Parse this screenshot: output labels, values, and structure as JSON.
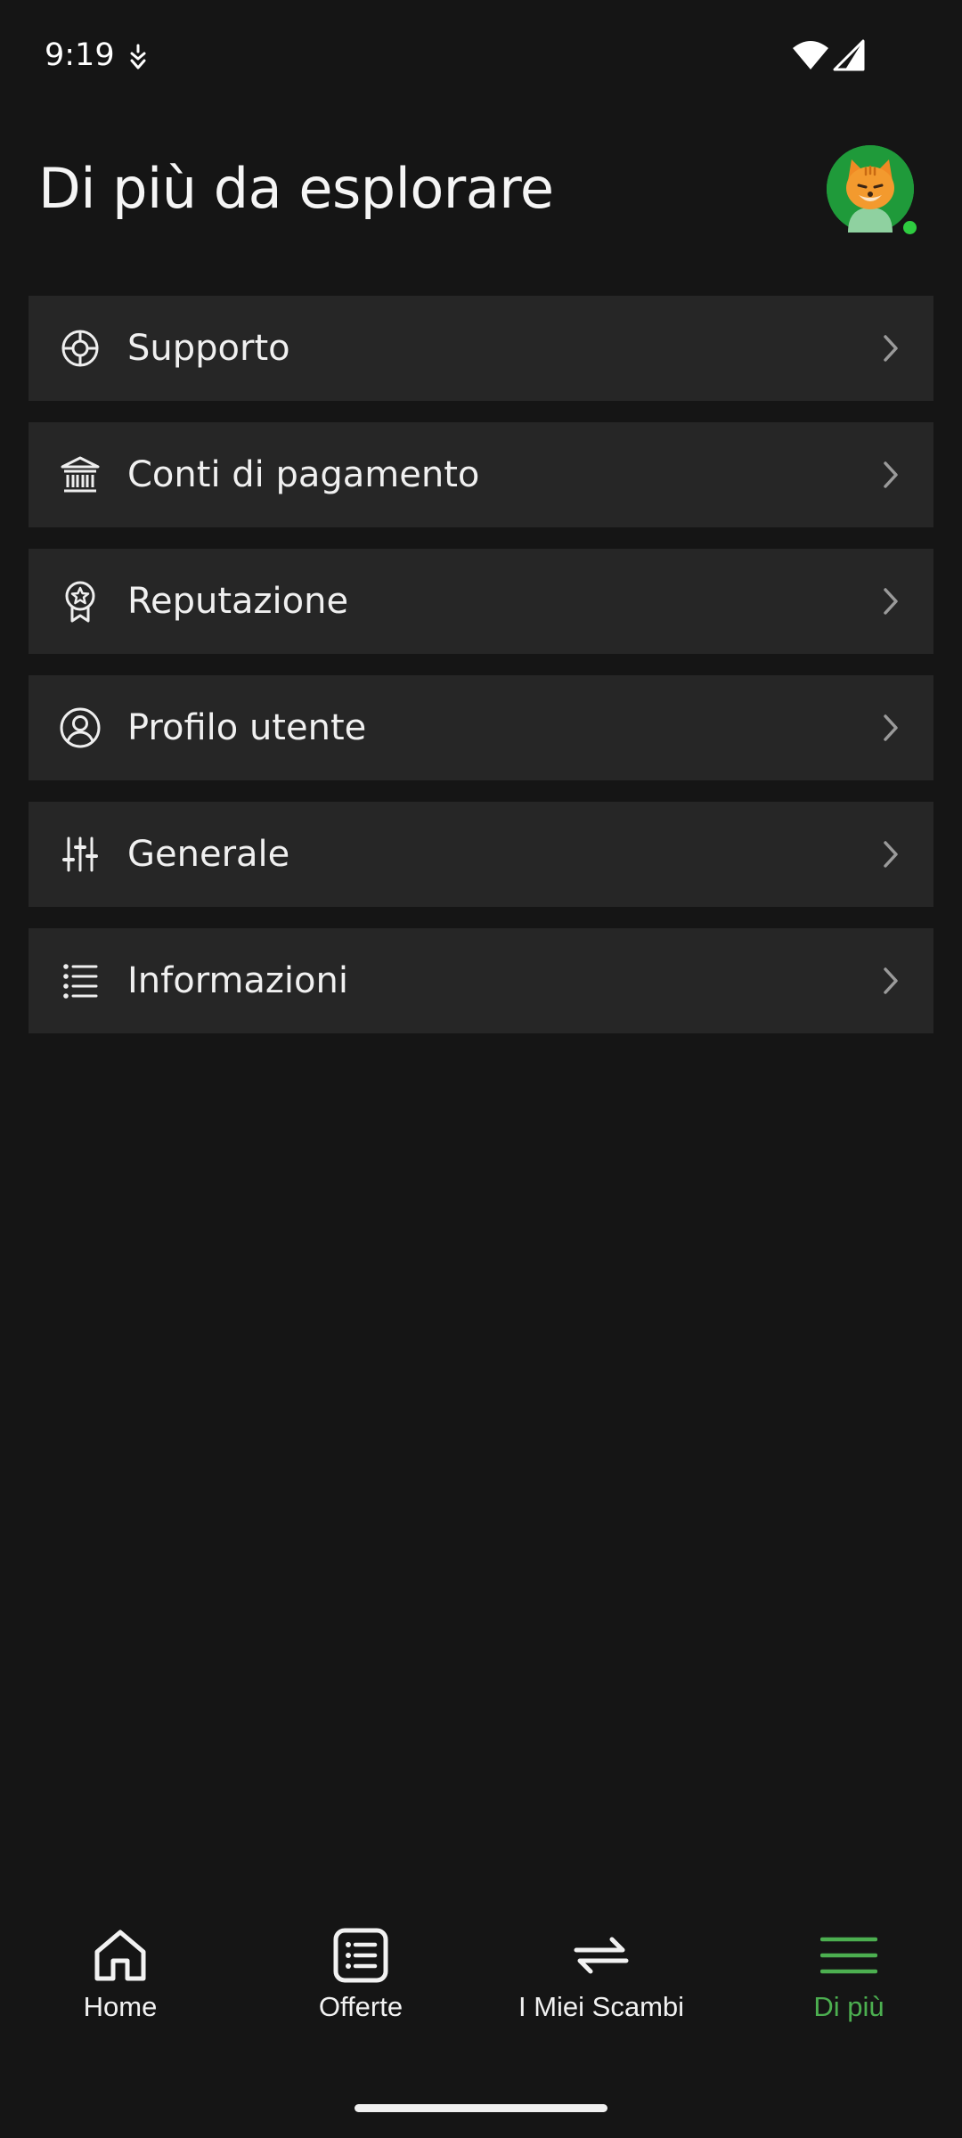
{
  "status_bar": {
    "time": "9:19"
  },
  "header": {
    "title": "Di più da esplorare"
  },
  "menu": {
    "items": [
      {
        "label": "Supporto",
        "icon": "lifebuoy-icon"
      },
      {
        "label": "Conti di pagamento",
        "icon": "bank-icon"
      },
      {
        "label": "Reputazione",
        "icon": "badge-star-icon"
      },
      {
        "label": "Profilo utente",
        "icon": "user-circle-icon"
      },
      {
        "label": "Generale",
        "icon": "sliders-icon"
      },
      {
        "label": "Informazioni",
        "icon": "list-icon"
      }
    ]
  },
  "bottom_nav": {
    "items": [
      {
        "label": "Home",
        "icon": "home-icon",
        "active": false
      },
      {
        "label": "Offerte",
        "icon": "offers-list-icon",
        "active": false
      },
      {
        "label": "I Miei Scambi",
        "icon": "swap-arrows-icon",
        "active": false
      },
      {
        "label": "Di più",
        "icon": "menu-icon",
        "active": true
      }
    ]
  },
  "colors": {
    "background": "#151515",
    "card": "#262626",
    "accent": "#4caf50",
    "avatar_bg": "#1f9a3a"
  }
}
